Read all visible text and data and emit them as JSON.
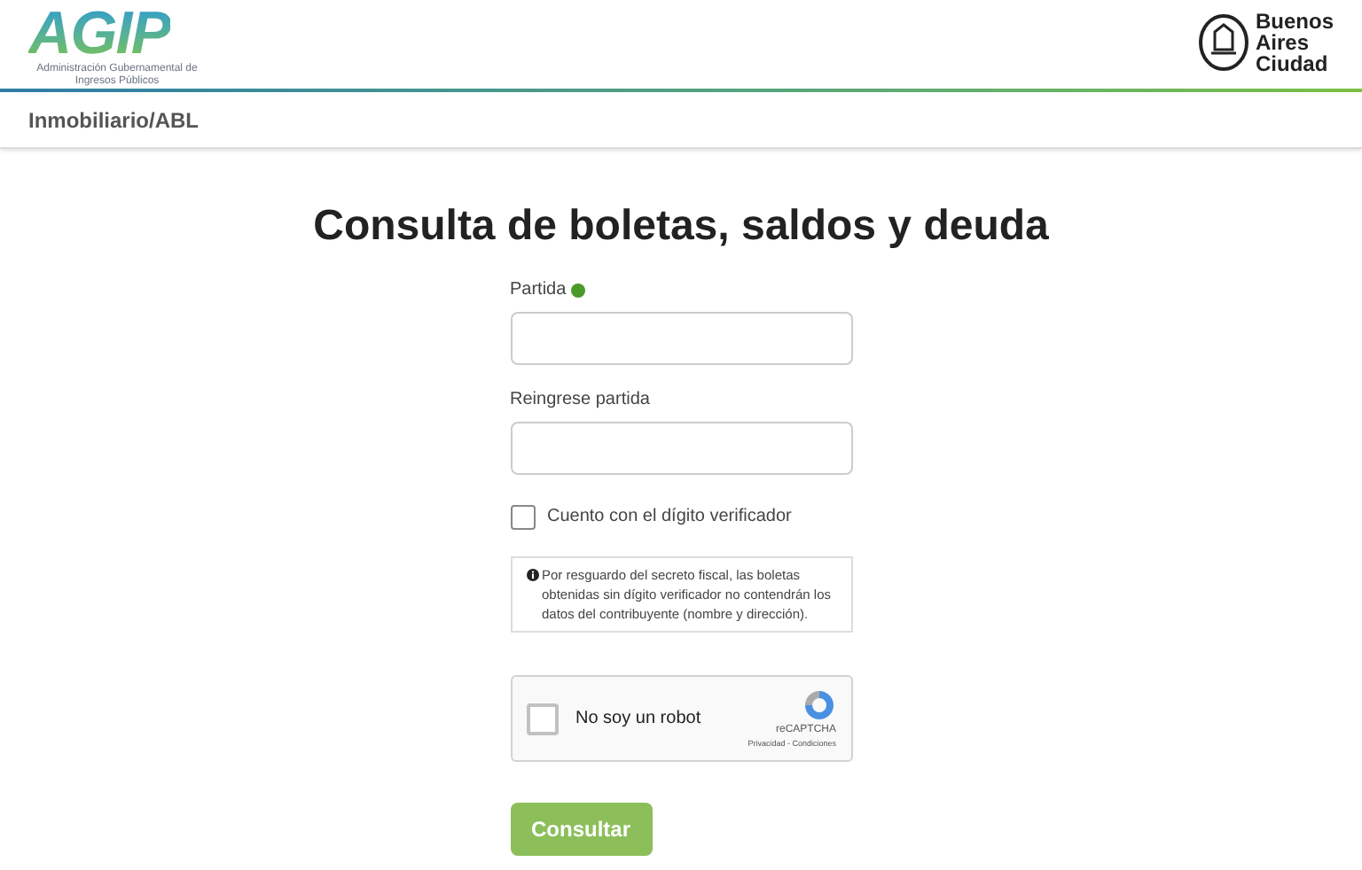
{
  "header": {
    "logo": "AGIP",
    "logo_subtitle": "Administración Gubernamental de Ingresos Públicos",
    "city_logo": [
      "Buenos",
      "Aires",
      "Ciudad"
    ]
  },
  "breadcrumb": "Inmobiliario/ABL",
  "title": "Consulta de boletas, saldos y deuda",
  "fields": [
    {
      "label": "Partida",
      "help": true
    },
    {
      "label": "Reingrese partida",
      "help": false
    }
  ],
  "checkbox": {
    "label": "Cuento con el dígito verificador",
    "checked": false
  },
  "note": "Por resguardo del secreto fiscal, las boletas obtenidas sin dígito verificador no contendrán los datos del contribuyente (nombre y dirección).",
  "captcha": {
    "label": "No soy un robot",
    "checked": false,
    "brand": "reCAPTCHA",
    "links": "Privacidad - Condiciones"
  },
  "submit": "Consultar"
}
